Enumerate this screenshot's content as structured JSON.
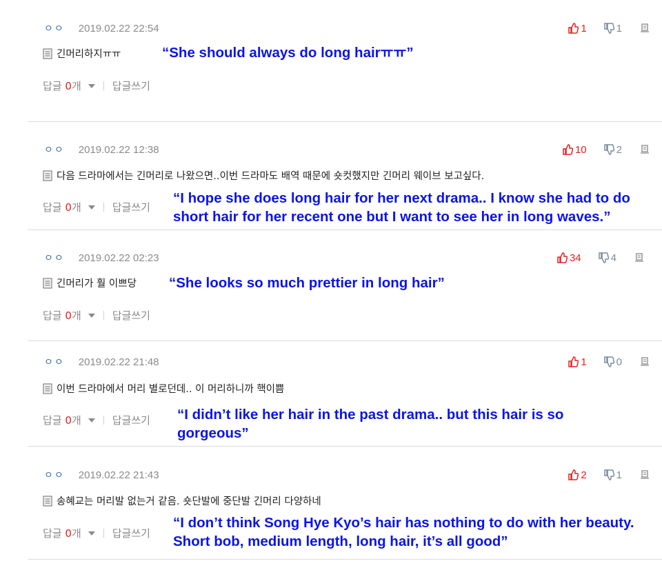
{
  "comments": [
    {
      "author": "ㅇㅇ",
      "date": "2019.02.22 22:54",
      "up": "1",
      "down": "1",
      "text": "긴머리하지ㅠㅠ",
      "translation": "“She should always do long hairㅠㅠ”",
      "reply_label": "답글",
      "reply_count": "0",
      "reply_unit": "개",
      "write_reply": "답글쓰기"
    },
    {
      "author": "ㅇㅇ",
      "date": "2019.02.22 12:38",
      "up": "10",
      "down": "2",
      "text": "다음 드라마에서는 긴머리로 나왔으면..이번 드라마도 배역 때문에 숏컷했지만 긴머리 웨이브 보고싶다.",
      "translation": "“I hope she does long hair for her next drama.. I know she had to do short hair for her recent one but I want to see her in long waves.”",
      "reply_label": "답글",
      "reply_count": "0",
      "reply_unit": "개",
      "write_reply": "답글쓰기"
    },
    {
      "author": "ㅇㅇ",
      "date": "2019.02.22 02:23",
      "up": "34",
      "down": "4",
      "text": "긴머리가 훨 이쁘당",
      "translation": "“She looks so much prettier in long hair”",
      "reply_label": "답글",
      "reply_count": "0",
      "reply_unit": "개",
      "write_reply": "답글쓰기"
    },
    {
      "author": "ㅇㅇ",
      "date": "2019.02.22 21:48",
      "up": "1",
      "down": "0",
      "text": "이번 드라마에서 머리 별로던데.. 이 머리하니까 핵이쁨",
      "translation": "“I didn’t like her hair in the past drama.. but this hair is so gorgeous”",
      "reply_label": "답글",
      "reply_count": "0",
      "reply_unit": "개",
      "write_reply": "답글쓰기"
    },
    {
      "author": "ㅇㅇ",
      "date": "2019.02.22 21:43",
      "up": "2",
      "down": "1",
      "text": "송혜교는 머리발 없는거 같음. 숏단발에 중단발 긴머리 다양하네",
      "translation": "“I don’t think Song Hye Kyo’s hair has nothing to do with her beauty. Short bob, medium length, long hair, it’s all good”",
      "reply_label": "답글",
      "reply_count": "0",
      "reply_unit": "개",
      "write_reply": "답글쓰기"
    }
  ],
  "colors": {
    "accent_red": "#e02020",
    "translation_blue": "#0a14e8",
    "muted": "#8a8a8a"
  },
  "icons": {
    "upvote": "thumbs-up-icon",
    "downvote": "thumbs-down-icon",
    "report": "report-icon",
    "comment": "document-icon",
    "expand": "caret-down-icon"
  }
}
